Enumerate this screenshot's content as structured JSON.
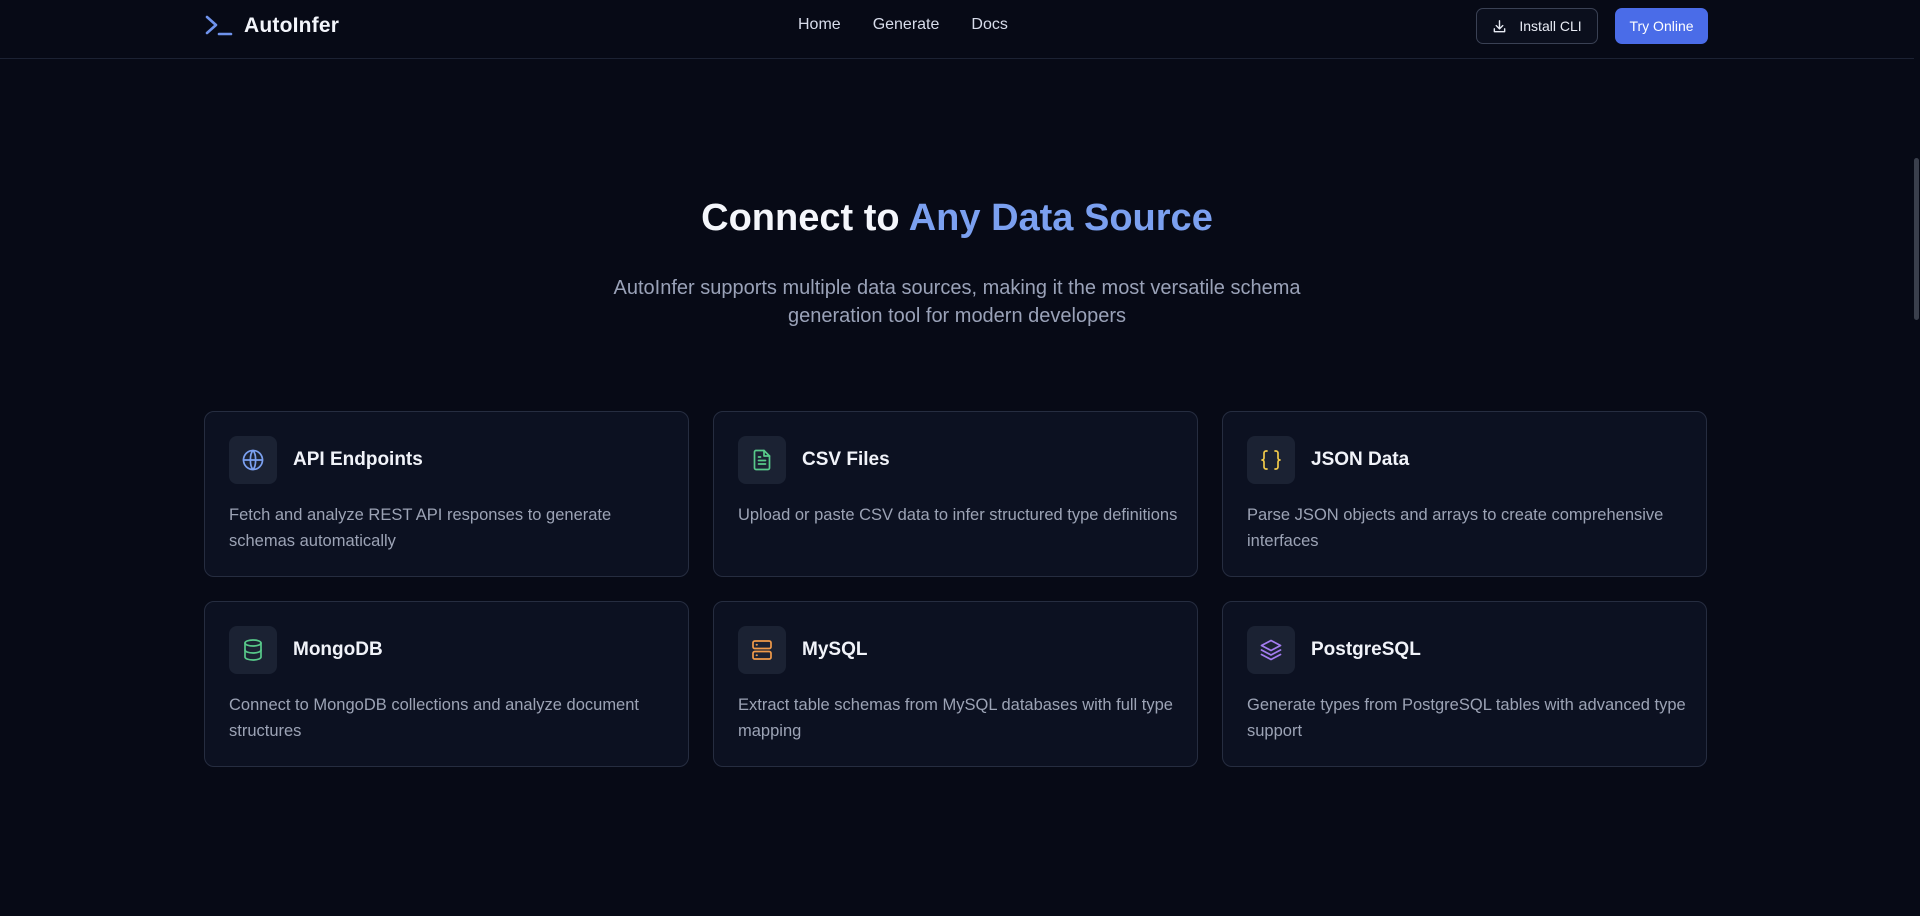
{
  "nav": {
    "brand": "AutoInfer",
    "links": [
      "Home",
      "Generate",
      "Docs"
    ],
    "install_label": "Install CLI",
    "try_label": "Try Online"
  },
  "hero": {
    "title_plain": "Connect to ",
    "title_accent": "Any Data Source",
    "subtitle": "AutoInfer supports multiple data sources, making it the most versatile schema generation tool for modern developers"
  },
  "cards": [
    {
      "title": "API Endpoints",
      "description": "Fetch and analyze REST API responses to generate schemas automatically",
      "icon": "globe-icon",
      "color": "#7ba0f0"
    },
    {
      "title": "CSV Files",
      "description": "Upload or paste CSV data to infer structured type definitions",
      "icon": "file-text-icon",
      "color": "#58c98a"
    },
    {
      "title": "JSON Data",
      "description": "Parse JSON objects and arrays to create comprehensive interfaces",
      "icon": "braces-icon",
      "color": "#f0c84a"
    },
    {
      "title": "MongoDB",
      "description": "Connect to MongoDB collections and analyze document structures",
      "icon": "database-icon",
      "color": "#58c98a"
    },
    {
      "title": "MySQL",
      "description": "Extract table schemas from MySQL databases with full type mapping",
      "icon": "server-icon",
      "color": "#f09a4a"
    },
    {
      "title": "PostgreSQL",
      "description": "Generate types from PostgreSQL tables with advanced type support",
      "icon": "layers-icon",
      "color": "#a37cf0"
    }
  ],
  "colors": {
    "background": "#070a16",
    "accent": "#7ba0f0",
    "primary_button": "#4a6ce8",
    "card_background": "#0c1121",
    "card_border": "#262d40"
  }
}
